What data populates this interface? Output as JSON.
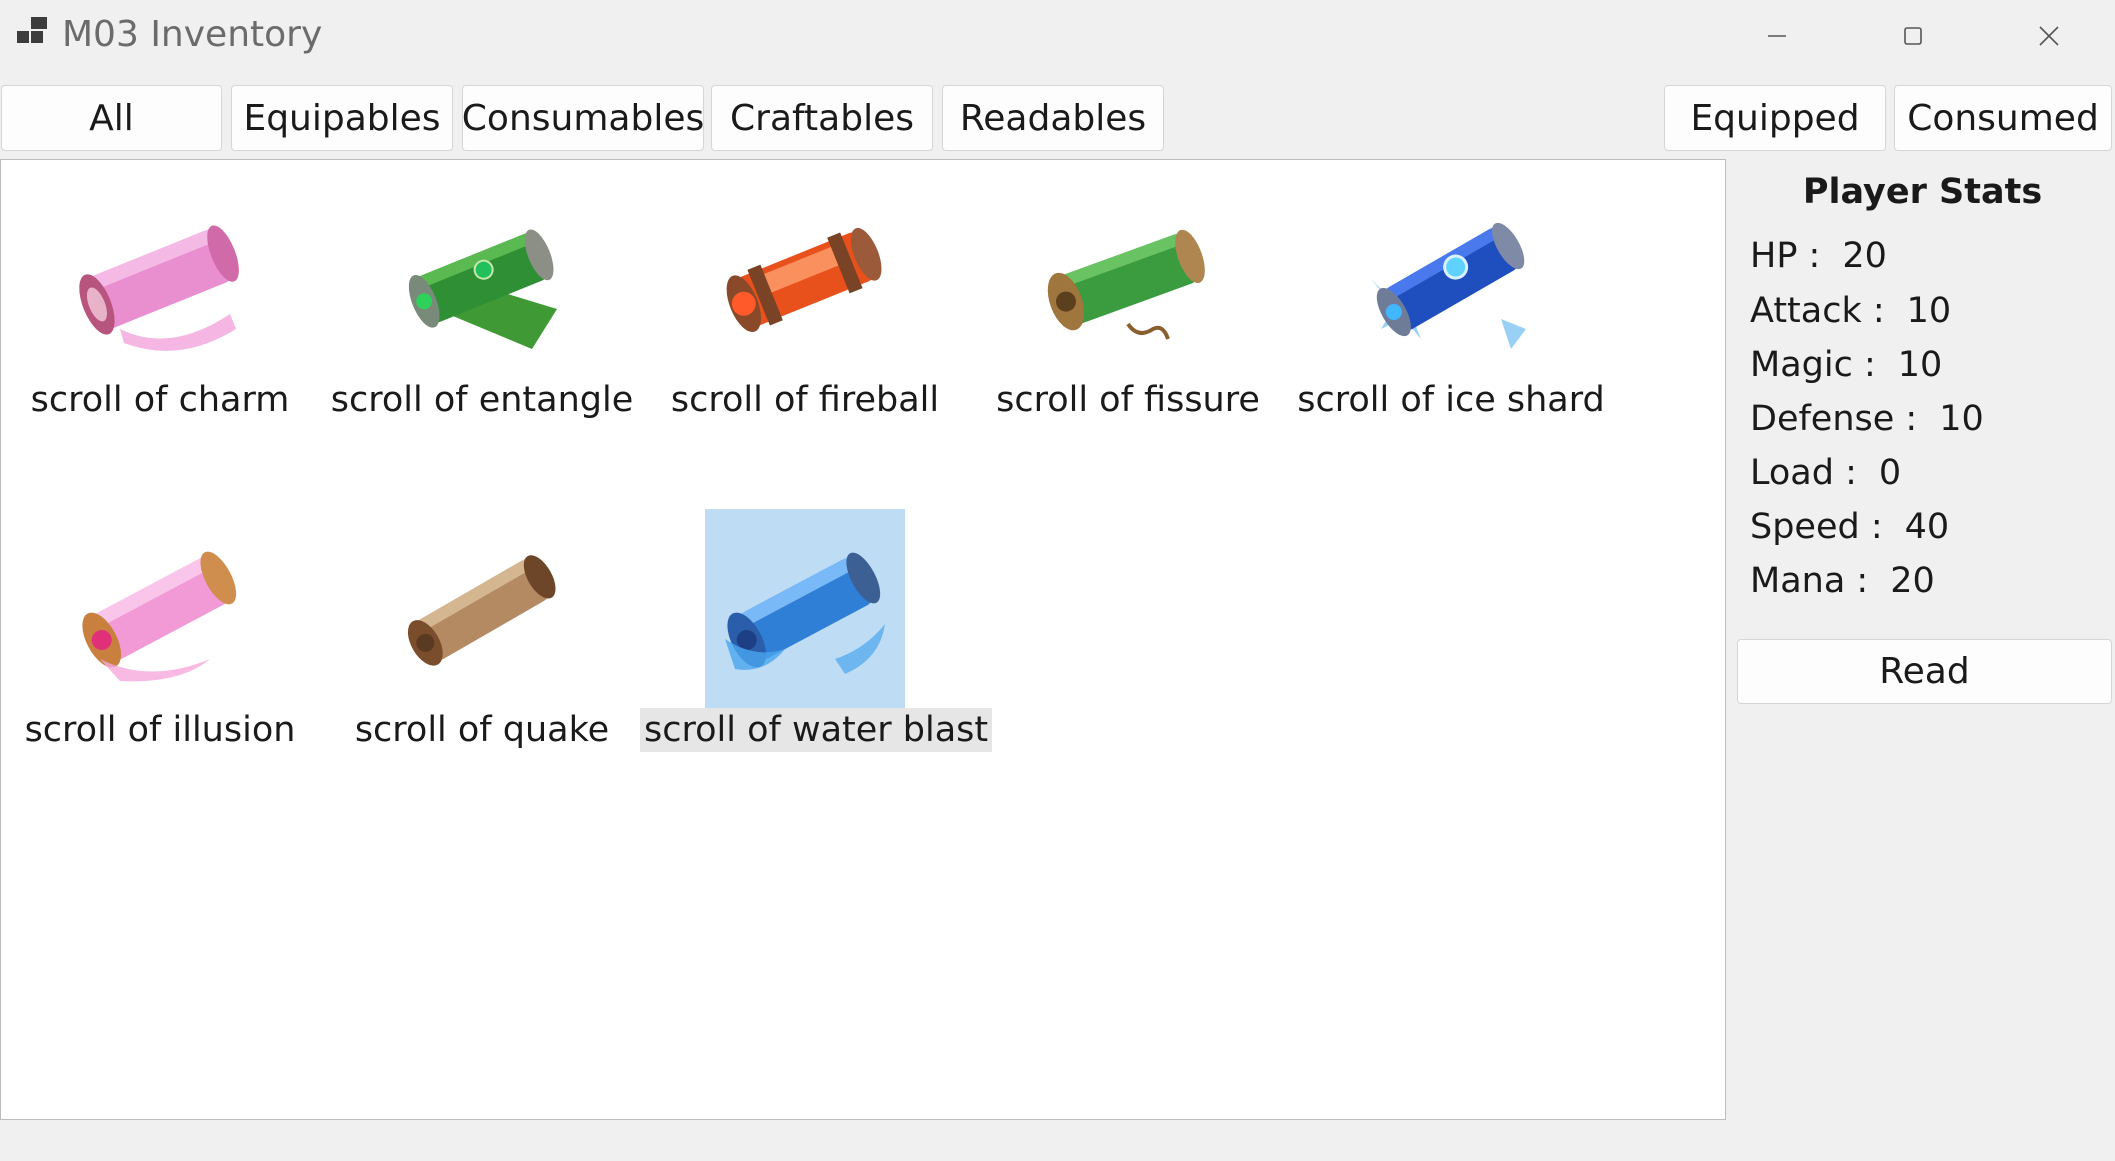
{
  "window": {
    "title": "M03 Inventory"
  },
  "tabs": {
    "all": "All",
    "equipables": "Equipables",
    "consumables": "Consumables",
    "craftables": "Craftables",
    "readables": "Readables",
    "equipped": "Equipped",
    "consumed": "Consumed"
  },
  "items": [
    {
      "label": "scroll of charm",
      "icon": "scroll-charm-icon",
      "color": "#e98fd0"
    },
    {
      "label": "scroll of entangle",
      "icon": "scroll-entangle-icon",
      "color": "#3da33a"
    },
    {
      "label": "scroll of fireball",
      "icon": "scroll-fireball-icon",
      "color": "#e8501c"
    },
    {
      "label": "scroll of fissure",
      "icon": "scroll-fissure-icon",
      "color": "#3a9c3f"
    },
    {
      "label": "scroll of ice shard",
      "icon": "scroll-ice-shard-icon",
      "color": "#1f4fbf"
    },
    {
      "label": "scroll of illusion",
      "icon": "scroll-illusion-icon",
      "color": "#f29ad6"
    },
    {
      "label": "scroll of quake",
      "icon": "scroll-quake-icon",
      "color": "#b48a63"
    },
    {
      "label": "scroll of water blast",
      "icon": "scroll-water-blast-icon",
      "color": "#2f7fd6",
      "selected": true
    }
  ],
  "stats": {
    "title": "Player Stats",
    "hp": {
      "label": "HP :",
      "value": "20"
    },
    "attack": {
      "label": "Attack :",
      "value": "10"
    },
    "magic": {
      "label": "Magic :",
      "value": "10"
    },
    "defense": {
      "label": "Defense :",
      "value": "10"
    },
    "load": {
      "label": "Load :",
      "value": "0"
    },
    "speed": {
      "label": "Speed :",
      "value": "40"
    },
    "mana": {
      "label": "Mana :",
      "value": "20"
    }
  },
  "actions": {
    "read": "Read"
  },
  "colors": {
    "selection": "#bfdcf5",
    "window_bg": "#f0f0f0"
  }
}
